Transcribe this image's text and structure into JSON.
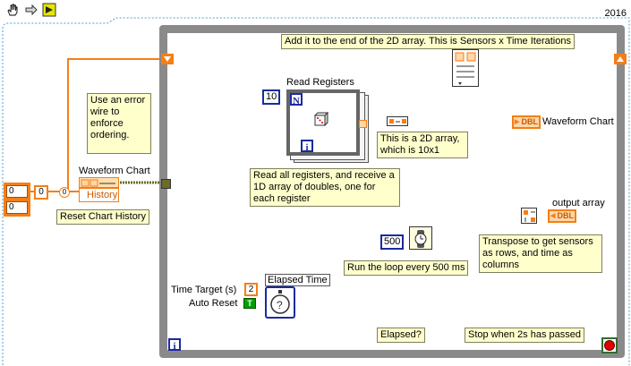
{
  "toolbar": {
    "icons": [
      "hand-icon",
      "forward-icon",
      "run-icon"
    ],
    "version": "2016"
  },
  "notes": {
    "error_wire": "Use an error wire to enforce ordering.",
    "add_to_end": "Add it to the end of the 2D array. This is Sensors x Time Iterations",
    "is_2d_array": "This is a 2D array, which is 10x1",
    "read_all": "Read all registers, and receive a 1D array of doubles, one for each register",
    "transpose": "Transpose to get sensors as rows, and time as columns",
    "run_loop": "Run the loop every 500 ms",
    "elapsed": "Elapsed?",
    "stop_when": "Stop when 2s has passed",
    "reset_history": "Reset Chart History"
  },
  "labels": {
    "read_registers": "Read Registers",
    "waveform_chart_outer": "Waveform Chart",
    "waveform_chart_inner": "Waveform Chart",
    "output_array": "output array",
    "elapsed_time": "Elapsed Time",
    "time_target": "Time Target (s)",
    "auto_reset": "Auto Reset",
    "history": "History",
    "dbl": "DBL",
    "loop_n": "N",
    "loop_i": "i"
  },
  "constants": {
    "count_10": "10",
    "wait_500": "500",
    "time_target_value": "2",
    "bool_true": "T",
    "array_vals": [
      "0",
      "0"
    ],
    "array_index": "0",
    "zero": "0"
  },
  "colors": {
    "loop_frame": "#8a8a8a",
    "wire_orange": "#f57e16",
    "wire_blue": "#1a2aa0",
    "error_wire": "#6b6b2a",
    "note_bg": "#ffffcc"
  }
}
